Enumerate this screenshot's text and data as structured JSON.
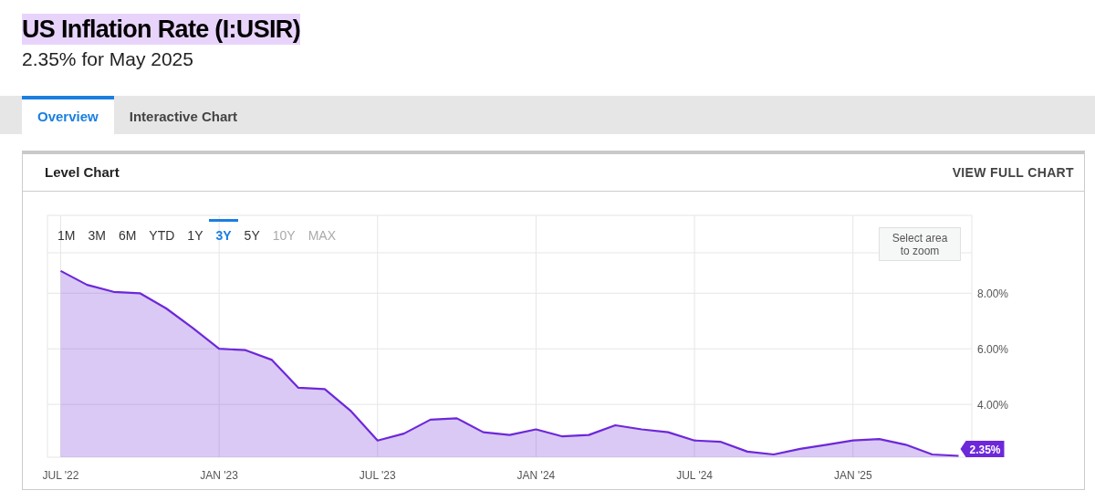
{
  "header": {
    "title": "US Inflation Rate (I:USIR)",
    "subtitle": "2.35% for May 2025"
  },
  "tabs": [
    {
      "label": "Overview",
      "selected": true
    },
    {
      "label": "Interactive Chart",
      "selected": false
    }
  ],
  "card": {
    "title": "Level Chart",
    "link": "VIEW FULL CHART",
    "ranges": [
      {
        "label": "1M",
        "selected": false,
        "disabled": false
      },
      {
        "label": "3M",
        "selected": false,
        "disabled": false
      },
      {
        "label": "6M",
        "selected": false,
        "disabled": false
      },
      {
        "label": "YTD",
        "selected": false,
        "disabled": false
      },
      {
        "label": "1Y",
        "selected": false,
        "disabled": false
      },
      {
        "label": "3Y",
        "selected": true,
        "disabled": false
      },
      {
        "label": "5Y",
        "selected": false,
        "disabled": false
      },
      {
        "label": "10Y",
        "selected": false,
        "disabled": true
      },
      {
        "label": "MAX",
        "selected": false,
        "disabled": true
      }
    ],
    "zoom_hint": "Select area to zoom",
    "last_value": "2.35%",
    "chart_data": {
      "type": "area",
      "grid": true,
      "categories": [
        "JUL '22",
        null,
        null,
        null,
        null,
        null,
        "JAN '23",
        null,
        null,
        null,
        null,
        null,
        "JUL '23",
        null,
        null,
        null,
        null,
        null,
        "JAN '24",
        null,
        null,
        null,
        null,
        null,
        "JUL '24",
        null,
        null,
        null,
        null,
        null,
        "JAN '25",
        null,
        null,
        null,
        null
      ],
      "series": [
        {
          "color": "#6d28d9",
          "values": [
            8.8,
            8.3,
            8.05,
            8.0,
            7.45,
            6.75,
            6.0,
            5.95,
            5.6,
            4.6,
            4.55,
            3.75,
            2.7,
            2.95,
            3.45,
            3.5,
            3.0,
            2.9,
            3.1,
            2.85,
            2.9,
            3.25,
            3.1,
            3.0,
            2.7,
            2.65,
            2.3,
            2.2,
            2.4,
            2.55,
            2.7,
            2.75,
            2.55,
            2.2,
            2.15
          ]
        }
      ],
      "ylim": [
        2.1,
        10.8
      ],
      "yticks": [
        {
          "value": 4,
          "label": "4.00%"
        },
        {
          "value": 6,
          "label": "6.00%"
        },
        {
          "value": 8,
          "label": "8.00%"
        }
      ]
    }
  }
}
